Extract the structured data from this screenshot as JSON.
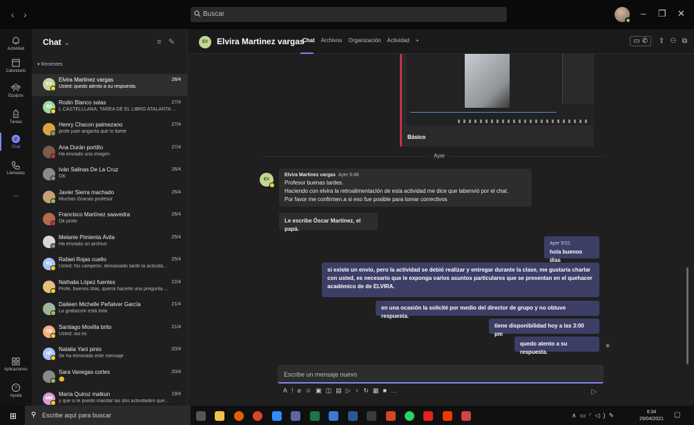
{
  "titlebar": {
    "search_placeholder": "Buscar",
    "back_label": "‹",
    "forward_label": "›",
    "min_label": "–",
    "max_label": "❐",
    "close_label": "✕"
  },
  "rail": [
    {
      "label": "Actividad",
      "icon": "bell-icon"
    },
    {
      "label": "Calendario",
      "icon": "calendar-icon"
    },
    {
      "label": "Equipos",
      "icon": "teams-icon"
    },
    {
      "label": "Tareas",
      "icon": "assignments-icon"
    },
    {
      "label": "Chat",
      "icon": "chat-icon",
      "active": true
    },
    {
      "label": "Llamadas",
      "icon": "phone-icon"
    },
    {
      "label": "...",
      "icon": "more-icon"
    },
    {
      "label": "Aplicaciones",
      "icon": "apps-icon"
    },
    {
      "label": "Ayuda",
      "icon": "help-icon"
    }
  ],
  "chatlist": {
    "title": "Chat",
    "section": "Recientes",
    "items": [
      {
        "name": "Elvira Martinez vargas",
        "preview": "Usted: quedo atento a su respuesta.",
        "date": "28/4",
        "initials": "EV",
        "color": "#c4d696",
        "status": "#f8d22a"
      },
      {
        "name": "Rodin Blanco salas",
        "preview": "L.CASTELLLANA: TAREA DE EL LIBRO ATALANTA ...",
        "date": "27/4",
        "initials": "RS",
        "color": "#9fd89f",
        "status": "#f8d22a"
      },
      {
        "name": "Henry Chacon palmezano",
        "preview": "profe juan angarita que lo llame",
        "date": "27/4",
        "initials": "",
        "color": "#d9a441",
        "status": "#8a8a8a"
      },
      {
        "name": "Ana Durán portillo",
        "preview": "Ha enviado una imagen",
        "date": "27/4",
        "initials": "",
        "color": "#7a5c4a",
        "status": "#c4314b"
      },
      {
        "name": "Iván Salinas De La Cruz",
        "preview": "OK",
        "date": "26/4",
        "initials": "",
        "color": "#8a8a8a",
        "status": "#8a8a8a"
      },
      {
        "name": "Javier Sierra machado",
        "preview": "Muchas Gracias profesor",
        "date": "26/4",
        "initials": "",
        "color": "#caa076",
        "status": "#92c353"
      },
      {
        "name": "Francisco Martínez saavedra",
        "preview": "Ok profe",
        "date": "26/4",
        "initials": "",
        "color": "#b56a4a",
        "status": "#c4314b"
      },
      {
        "name": "Melanie Pimienta Ávila",
        "preview": "Ha enviado un archivo",
        "date": "25/4",
        "initials": "",
        "color": "#d8d8d8",
        "status": "#8a8a8a"
      },
      {
        "name": "Rafael Rojas cuello",
        "preview": "Usted: No campeón, demasiado tarde la acticida...",
        "date": "25/4",
        "initials": "RC",
        "color": "#a9c4f5",
        "status": "#f8d22a"
      },
      {
        "name": "Nathalia López fuentes",
        "preview": "Profe, buenos días, quería hacerle una pregunta ...",
        "date": "22/4",
        "initials": "",
        "color": "#e5c07b",
        "status": "#f8d22a"
      },
      {
        "name": "Daileen Michelle Peñalver García",
        "preview": "La grabación está lista",
        "date": "21/4",
        "initials": "",
        "color": "#9fb59a",
        "status": "#92c353"
      },
      {
        "name": "Santiago Movilla brito",
        "preview": "Usted: asi es",
        "date": "21/4",
        "initials": "SB",
        "color": "#f4b183",
        "status": "#f8d22a"
      },
      {
        "name": "Natalia Yani pinto",
        "preview": "Se ha eliminado este mensaje",
        "date": "20/4",
        "initials": "NP",
        "color": "#a9c4f5",
        "status": "#f8d22a"
      },
      {
        "name": "Sara Vanegas cortes",
        "preview": "😊",
        "date": "20/4",
        "initials": "",
        "color": "#8a8a8a",
        "status": "#92c353"
      },
      {
        "name": "María Quiroz malkun",
        "preview": "y que si le puedo mandar las dos actividades que...",
        "date": "19/4",
        "initials": "MM",
        "color": "#d99ad9",
        "status": "#f8d22a"
      }
    ]
  },
  "main": {
    "contact_initials": "EV",
    "contact_name": "Elvira Martinez vargas",
    "tabs": [
      "Chat",
      "Archivos",
      "Organización",
      "Actividad",
      "+"
    ],
    "card_caption": "Básico",
    "day_divider": "Ayer",
    "incoming": {
      "sender": "Elvira Martinez vargas",
      "time": "Ayer 9:48",
      "lines": [
        "Profesor buenas tardes.",
        "Haciendo con elvira la retroalimentación de esta actividad me dice que labenvió por el chat.",
        "Por favor me confirmen.a si eso fue posible para tomar correctivos"
      ],
      "line2": "Le escribe Óscar Martínez, el papá."
    },
    "outgoing": [
      {
        "meta": "Ayer 9:51",
        "text": "hola buenos dias"
      },
      {
        "text": "si existe un envío, pero la actividad se debió realizar y entregar durante la clase,  me gustaría charlar con usted, es necesario que le exponga varios asuntos particulares que se presentan en el quehacer académico de de ELVIRA."
      },
      {
        "text": "en una ocasión la solicité por medio del director de grupo y no obtuve respuesta."
      },
      {
        "text": "tiene disponibilidad hoy a las 3:00 pm"
      },
      {
        "text": "quedo atento a su respuesta."
      }
    ],
    "compose_placeholder": "Escribe un mensaje nuevo"
  },
  "taskbar": {
    "search_placeholder": "Escribe aquí para buscar",
    "time": "6:34",
    "date": "29/04/2021"
  }
}
